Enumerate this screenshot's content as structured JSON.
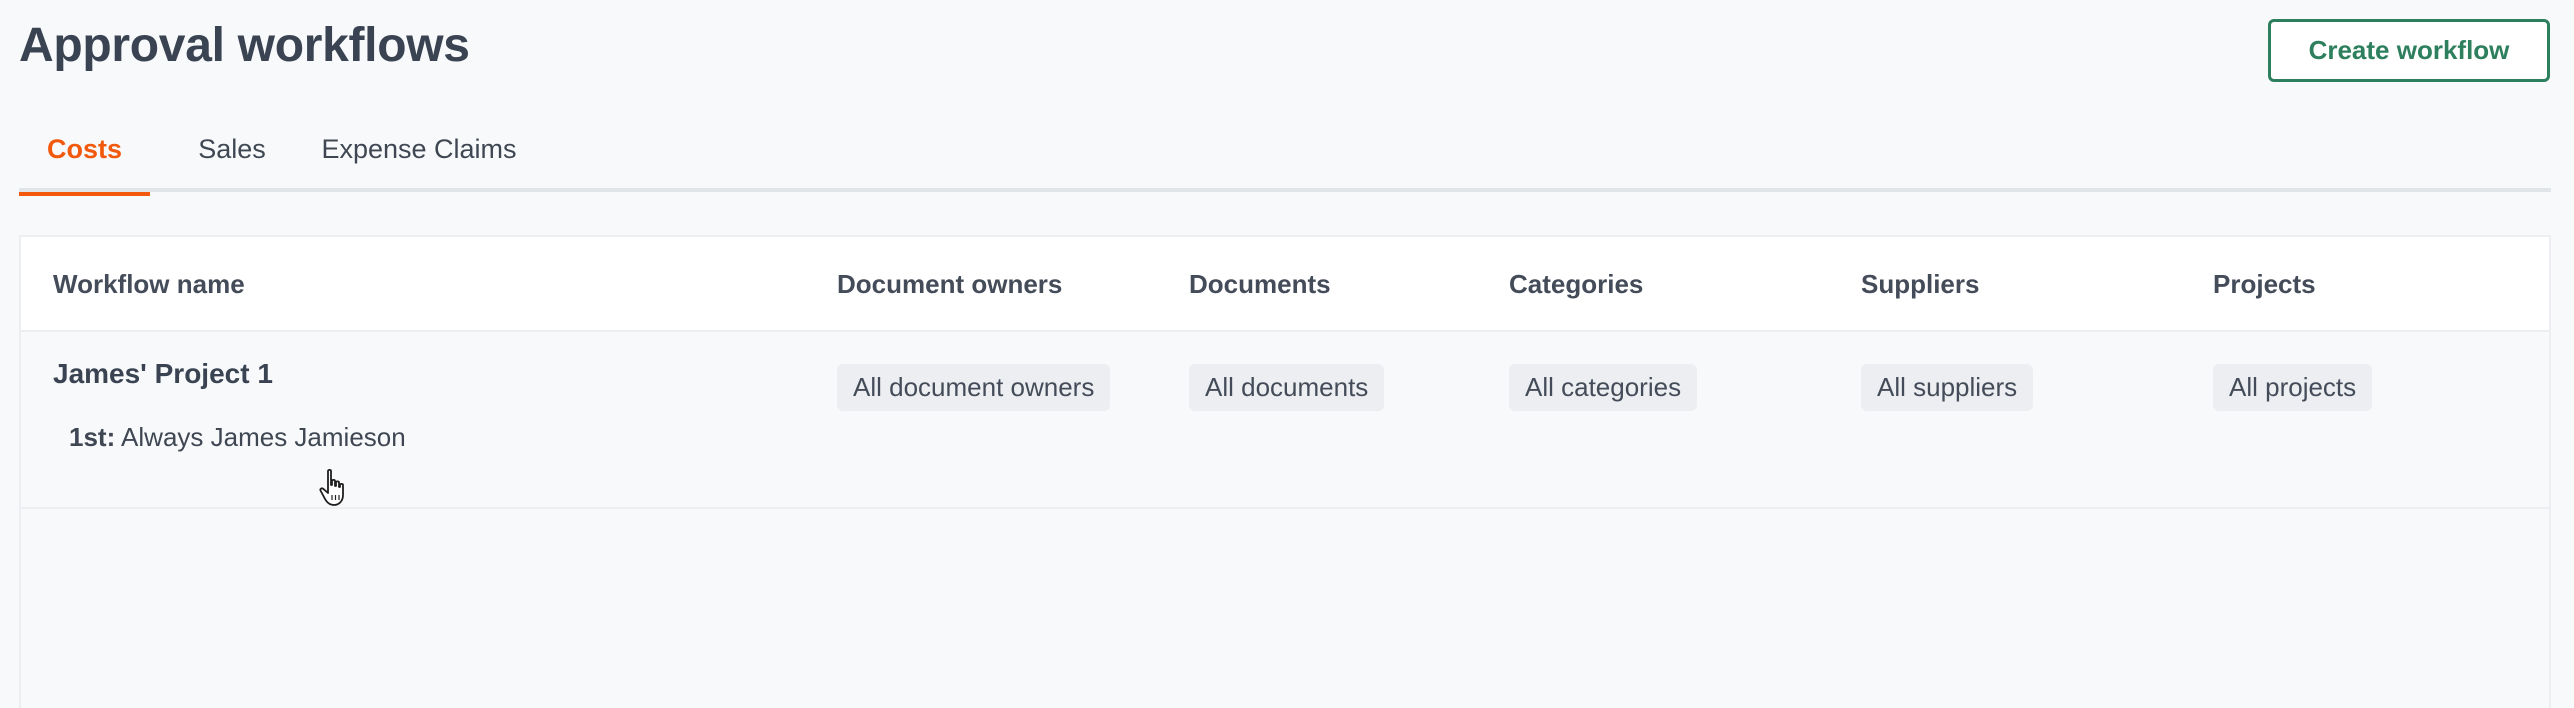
{
  "page": {
    "title": "Approval workflows",
    "create_button_label": "Create workflow"
  },
  "tabs": [
    {
      "label": "Costs",
      "active": true
    },
    {
      "label": "Sales",
      "active": false
    },
    {
      "label": "Expense Claims",
      "active": false
    }
  ],
  "table": {
    "columns": [
      "Workflow name",
      "Document owners",
      "Documents",
      "Categories",
      "Suppliers",
      "Projects"
    ],
    "rows": [
      {
        "name": "James' Project 1",
        "step_ordinal": "1st:",
        "step_text": "Always James Jamieson",
        "document_owners": "All document owners",
        "documents": "All documents",
        "categories": "All categories",
        "suppliers": "All suppliers",
        "projects": "All projects"
      }
    ]
  },
  "colors": {
    "accent_tab": "#f2590c",
    "primary_button": "#2d7f5e",
    "text": "#3f4753",
    "background": "#f8f9fb"
  },
  "icons": {
    "cursor": "hand-pointer-icon"
  }
}
